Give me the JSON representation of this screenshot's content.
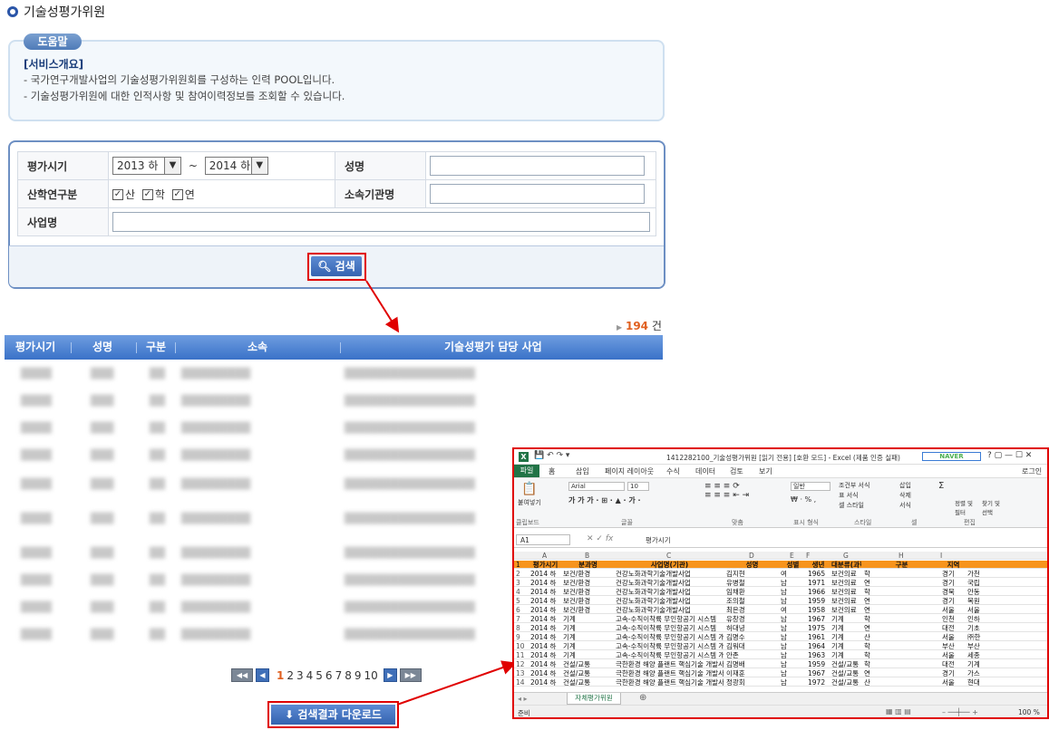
{
  "page": {
    "title": "기술성평가위원"
  },
  "help": {
    "tag": "도움말",
    "heading": "[서비스개요]",
    "line1": "- 국가연구개발사업의 기술성평가위원회를 구성하는 인력 POOL입니다.",
    "line2": "- 기술성평가위원에 대한 인적사항 및 참여이력정보를 조회할 수 있습니다."
  },
  "search": {
    "period_label": "평가시기",
    "period_from": "2013 하",
    "period_to": "2014 하",
    "tilde": "~",
    "name_label": "성명",
    "type_label": "산학연구분",
    "type_options": [
      "산",
      "학",
      "연"
    ],
    "org_label": "소속기관명",
    "project_label": "사업명",
    "button": "검색"
  },
  "results": {
    "count": "194",
    "count_unit": "건",
    "columns": [
      "평가시기",
      "성명",
      "구분",
      "소속",
      "기술성평가 담당 사업"
    ]
  },
  "pager": {
    "pages": [
      "1",
      "2",
      "3",
      "4",
      "5",
      "6",
      "7",
      "8",
      "9",
      "10"
    ],
    "current": "1"
  },
  "download_button": "검색결과 다운로드",
  "excel": {
    "window_title": "1412282100_기술성평가위원 [읽기 전용] [호환 모드] - Excel (제품 인증 실패)",
    "search_logo": "NAVER",
    "login": "로그인",
    "ribbon_tabs": [
      "파일",
      "홈",
      "삽입",
      "페이지 레이아웃",
      "수식",
      "데이터",
      "검토",
      "보기"
    ],
    "groups": [
      "클립보드",
      "글꼴",
      "맞춤",
      "표시 형식",
      "스타일",
      "셀",
      "편집"
    ],
    "font_name": "Arial",
    "font_size": "10",
    "number_format": "일반",
    "paste": "붙여넣기",
    "styles": [
      "조건부 서식",
      "표 서식",
      "셀 스타일"
    ],
    "cells": [
      "삽입",
      "삭제",
      "서식"
    ],
    "edit": [
      "정렬 및 필터",
      "찾기 및 선택"
    ],
    "name_box": "A1",
    "formula": "평가시기",
    "col_letters": [
      "A",
      "B",
      "C",
      "D",
      "E",
      "F",
      "G",
      "H",
      "I"
    ],
    "header": [
      "평가시기",
      "분과명",
      "사업명(기관)",
      "성명",
      "성별",
      "생년",
      "대분류(과학기술표준분류)",
      "구분",
      "지역"
    ],
    "rows": [
      [
        "2",
        "2014 하",
        "보건/환경",
        "건강노화과학기술개발사업",
        "김지현",
        "여",
        "1965",
        "보건의료",
        "학",
        "경기",
        "가천"
      ],
      [
        "3",
        "2014 하",
        "보건/환경",
        "건강노화과학기술개발사업",
        "유병철",
        "남",
        "1971",
        "보건의료",
        "연",
        "경기",
        "국립"
      ],
      [
        "4",
        "2014 하",
        "보건/환경",
        "건강노화과학기술개발사업",
        "임채환",
        "남",
        "1966",
        "보건의료",
        "학",
        "경북",
        "안동"
      ],
      [
        "5",
        "2014 하",
        "보건/환경",
        "건강노화과학기술개발사업",
        "조의철",
        "남",
        "1959",
        "보건의료",
        "연",
        "경기",
        "목원"
      ],
      [
        "6",
        "2014 하",
        "보건/환경",
        "건강노화과학기술개발사업",
        "최은경",
        "여",
        "1958",
        "보건의료",
        "연",
        "서울",
        "서울"
      ],
      [
        "7",
        "2014 하",
        "기계",
        "고속-수직이착륙 무인항공기 시스템",
        "유창경",
        "남",
        "1967",
        "기계",
        "학",
        "인천",
        "인하"
      ],
      [
        "8",
        "2014 하",
        "기계",
        "고속-수직이착륙 무인항공기 시스템",
        "허대녕",
        "남",
        "1975",
        "기계",
        "연",
        "대전",
        "기초"
      ],
      [
        "9",
        "2014 하",
        "기계",
        "고속-수직이착륙 무인항공기 시스템 개발",
        "김명수",
        "남",
        "1961",
        "기계",
        "산",
        "서울",
        "㈜한"
      ],
      [
        "10",
        "2014 하",
        "기계",
        "고속-수직이착륙 무인항공기 시스템 개발",
        "김워대",
        "남",
        "1964",
        "기계",
        "학",
        "부산",
        "부산"
      ],
      [
        "11",
        "2014 하",
        "기계",
        "고속-수직이착륙 무인항공기 시스템 개발",
        "안존",
        "남",
        "1963",
        "기계",
        "학",
        "서울",
        "세종"
      ],
      [
        "12",
        "2014 하",
        "건설/교통",
        "극한환경 해양 플랜트 핵심기술 개발사업",
        "김명배",
        "남",
        "1959",
        "건설/교통",
        "학",
        "대전",
        "기계"
      ],
      [
        "13",
        "2014 하",
        "건설/교통",
        "극한환경 해양 플랜트 핵심기술 개발사업",
        "이재훈",
        "남",
        "1967",
        "건설/교통",
        "연",
        "경기",
        "가스"
      ],
      [
        "14",
        "2014 하",
        "건설/교통",
        "극한환경 해양 플랜트 핵심기술 개발사업",
        "정광회",
        "남",
        "1972",
        "건설/교통",
        "산",
        "서울",
        "현대"
      ]
    ],
    "sheet_tab": "자체평가위원",
    "status_ready": "준비",
    "zoom": "100 %"
  },
  "colors": {
    "accent": "#3a72c8",
    "highlight": "#e00000",
    "excel_green": "#217346",
    "header_orange": "#f7941d"
  }
}
